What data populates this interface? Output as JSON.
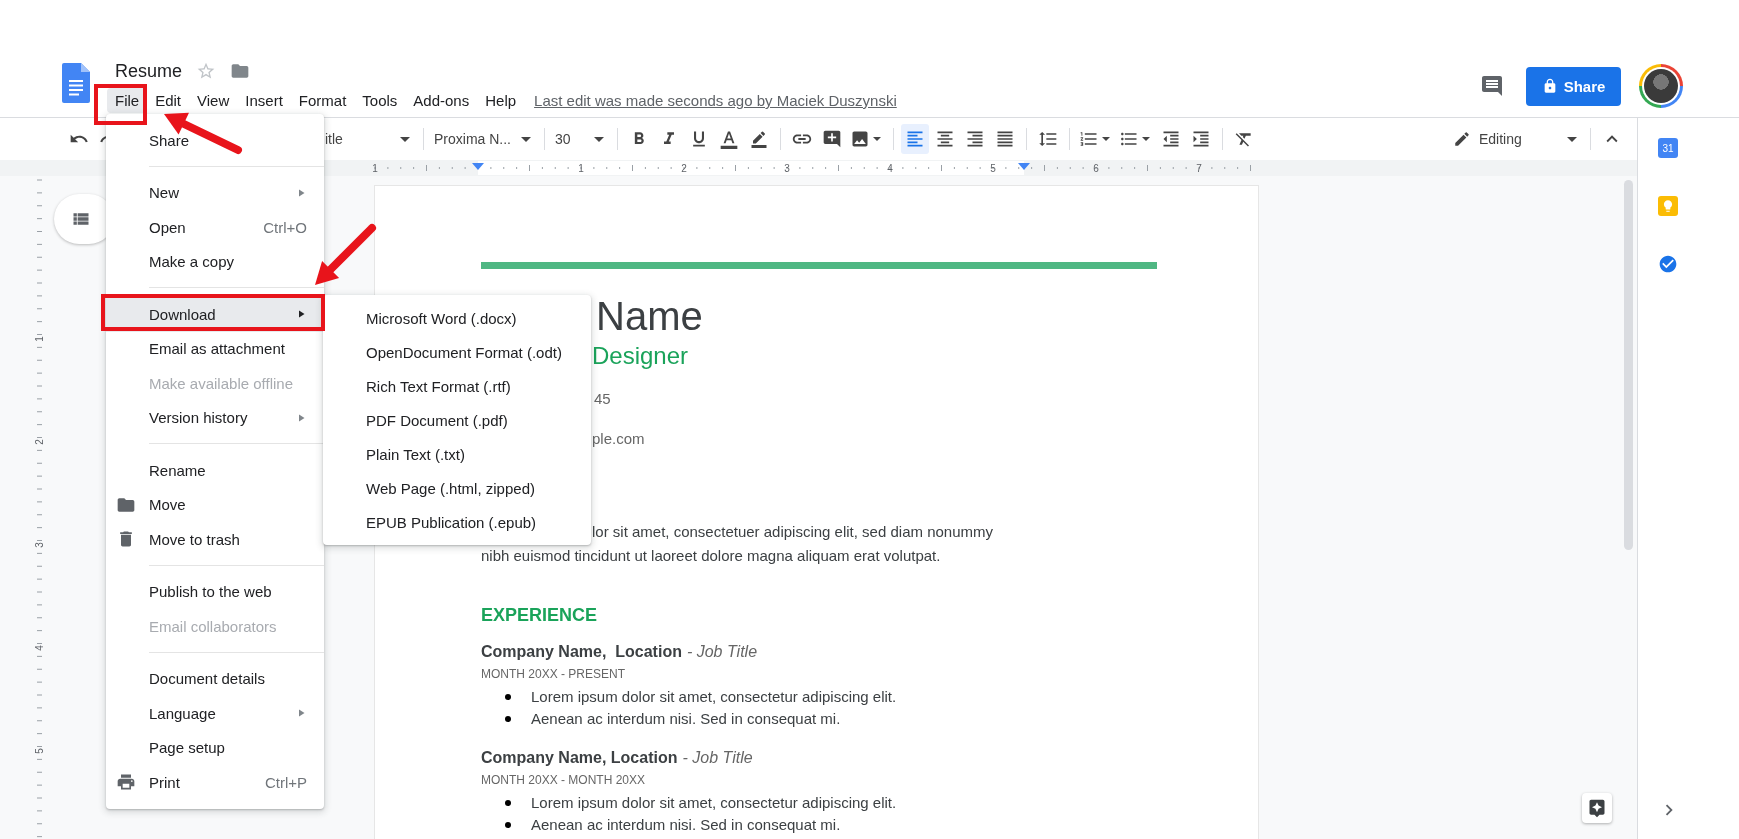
{
  "doc_title": "Resume",
  "menu_bar": [
    {
      "label": "File",
      "selected": true
    },
    {
      "label": "Edit",
      "selected": false
    },
    {
      "label": "View",
      "selected": false
    },
    {
      "label": "Insert",
      "selected": false
    },
    {
      "label": "Format",
      "selected": false
    },
    {
      "label": "Tools",
      "selected": false
    },
    {
      "label": "Add-ons",
      "selected": false
    },
    {
      "label": "Help",
      "selected": false
    }
  ],
  "last_edit": "Last edit was made seconds ago by Maciek Duszynski",
  "share_button": "Share",
  "toolbar": {
    "style": "itle",
    "font": "Proxima N...",
    "size": "30",
    "mode": "Editing",
    "align": [
      {
        "kind": "left",
        "selected": true
      },
      {
        "kind": "center",
        "selected": false
      },
      {
        "kind": "right",
        "selected": false
      },
      {
        "kind": "justify",
        "selected": false
      }
    ]
  },
  "ruler": {
    "numbers": [
      "1",
      "1",
      "2",
      "3",
      "4",
      "5",
      "6",
      "7"
    ]
  },
  "vertical_ruler": {
    "numbers": [
      "1",
      "2",
      "3",
      "4",
      "5"
    ]
  },
  "side_panel": {
    "calendar_day": "31"
  },
  "file_menu": [
    [
      {
        "label": "Share",
        "kind": "plain",
        "submenu": false,
        "disabled": false,
        "selected": false
      }
    ],
    [
      {
        "label": "New",
        "kind": "plain",
        "submenu": true,
        "disabled": false,
        "selected": false
      },
      {
        "label": "Open",
        "shortcut": "Ctrl+O",
        "kind": "plain",
        "submenu": false,
        "disabled": false,
        "selected": false
      },
      {
        "label": "Make a copy",
        "kind": "plain",
        "submenu": false,
        "disabled": false,
        "selected": false
      }
    ],
    [
      {
        "label": "Download",
        "kind": "plain",
        "submenu": true,
        "disabled": false,
        "selected": true
      },
      {
        "label": "Email as attachment",
        "kind": "plain",
        "submenu": false,
        "disabled": false,
        "selected": false
      },
      {
        "label": "Make available offline",
        "kind": "plain",
        "submenu": false,
        "disabled": true,
        "selected": false
      },
      {
        "label": "Version history",
        "kind": "plain",
        "submenu": true,
        "disabled": false,
        "selected": false
      }
    ],
    [
      {
        "label": "Rename",
        "kind": "plain",
        "submenu": false,
        "disabled": false,
        "selected": false
      },
      {
        "label": "Move",
        "kind": "folder",
        "submenu": false,
        "disabled": false,
        "selected": false
      },
      {
        "label": "Move to trash",
        "kind": "trash",
        "submenu": false,
        "disabled": false,
        "selected": false
      }
    ],
    [
      {
        "label": "Publish to the web",
        "kind": "plain",
        "submenu": false,
        "disabled": false,
        "selected": false
      },
      {
        "label": "Email collaborators",
        "kind": "plain",
        "submenu": false,
        "disabled": true,
        "selected": false
      }
    ],
    [
      {
        "label": "Document details",
        "kind": "plain",
        "submenu": false,
        "disabled": false,
        "selected": false
      },
      {
        "label": "Language",
        "kind": "plain",
        "submenu": true,
        "disabled": false,
        "selected": false
      },
      {
        "label": "Page setup",
        "kind": "plain",
        "submenu": false,
        "disabled": false,
        "selected": false
      },
      {
        "label": "Print",
        "shortcut": "Ctrl+P",
        "kind": "print",
        "submenu": false,
        "disabled": false,
        "selected": false
      }
    ]
  ],
  "download_menu": [
    "Microsoft Word (.docx)",
    "OpenDocument Format (.odt)",
    "Rich Text Format (.rtf)",
    "PDF Document (.pdf)",
    "Plain Text (.txt)",
    "Web Page (.html, zipped)",
    "EPUB Publication (.epub)"
  ],
  "page": {
    "name": "Name",
    "role": "Designer",
    "phone": "45",
    "email": "ple.com",
    "summary_line_1": "lor sit amet, consectetuer adipiscing elit, sed diam nonummy",
    "summary_line_2": "nibh euismod tincidunt ut laoreet dolore magna aliquam erat volutpat.",
    "section": "EXPERIENCE",
    "jobs": [
      {
        "company": "Company Name,  Location",
        "title": "- Job Title",
        "dates": "MONTH 20XX - PRESENT",
        "bullets": [
          "Lorem ipsum dolor sit amet, consectetur adipiscing elit.",
          "Aenean ac interdum nisi. Sed in consequat mi."
        ]
      },
      {
        "company": "Company Name, Location",
        "title": "- Job Title",
        "dates": "MONTH 20XX - MONTH 20XX",
        "bullets": [
          "Lorem ipsum dolor sit amet, consectetur adipiscing elit.",
          "Aenean ac interdum nisi. Sed in consequat mi."
        ]
      }
    ]
  }
}
